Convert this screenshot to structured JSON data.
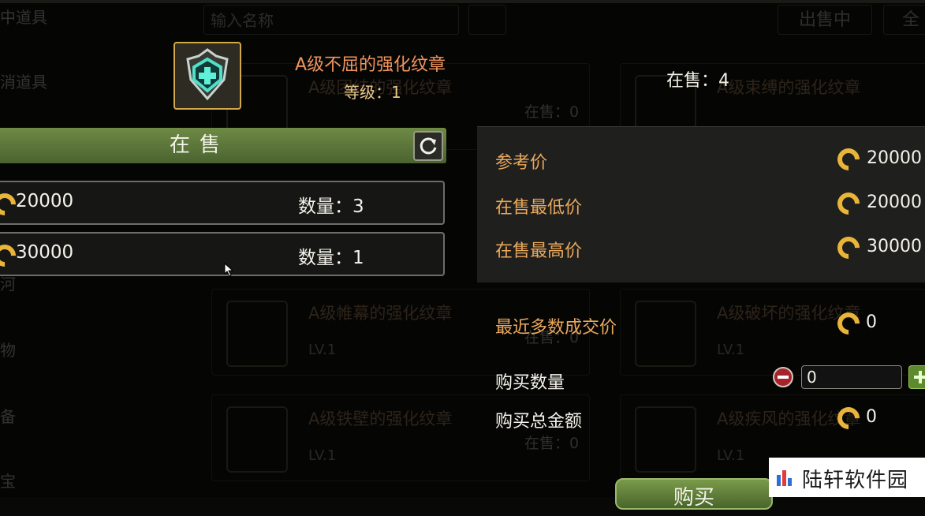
{
  "background": {
    "search_placeholder": "输入名称",
    "tab_selling": "出售中",
    "tab_all": "全",
    "sidebar": [
      "中道具",
      "消道具",
      "河",
      "物",
      "备",
      "宝"
    ],
    "cards": [
      {
        "name": "A级团结的强化纹章",
        "count": "在售：0"
      },
      {
        "name": "A级束缚的强化纹章",
        "count": ""
      },
      {
        "name": "A级帷幕的强化纹章",
        "level": "LV.1",
        "count": "在售：0"
      },
      {
        "name": "A级破坏的强化纹章",
        "level": "LV.1",
        "count": ""
      },
      {
        "name": "A级铁壁的强化纹章",
        "level": "LV.1",
        "count": "在售：0"
      },
      {
        "name": "A级疾风的强化纹章",
        "level": "LV.1",
        "count": ""
      }
    ]
  },
  "item": {
    "name": "A级不屈的强化纹章",
    "level": "等级：1",
    "on_sale": "在售：4",
    "icon": "shield-cross-emblem-icon"
  },
  "listing": {
    "title": "在售",
    "rows": [
      {
        "price": "20000",
        "qty": "数量：3"
      },
      {
        "price": "30000",
        "qty": "数量：1"
      }
    ]
  },
  "price_info": {
    "ref_label": "参考价",
    "ref_value": "20000",
    "min_label": "在售最低价",
    "min_value": "20000",
    "max_label": "在售最高价",
    "max_value": "30000",
    "recent_label": "最近多数成交价",
    "recent_value": "0",
    "buy_qty_label": "购买数量",
    "buy_qty_value": "0",
    "total_label": "购买总金额",
    "total_value": "0"
  },
  "buy_button": "购买",
  "watermark": "陆轩软件园",
  "colors": {
    "accent_gold": "#e8b43a",
    "label_orange": "#eaa85c",
    "header_green": "#5f7a3c"
  }
}
